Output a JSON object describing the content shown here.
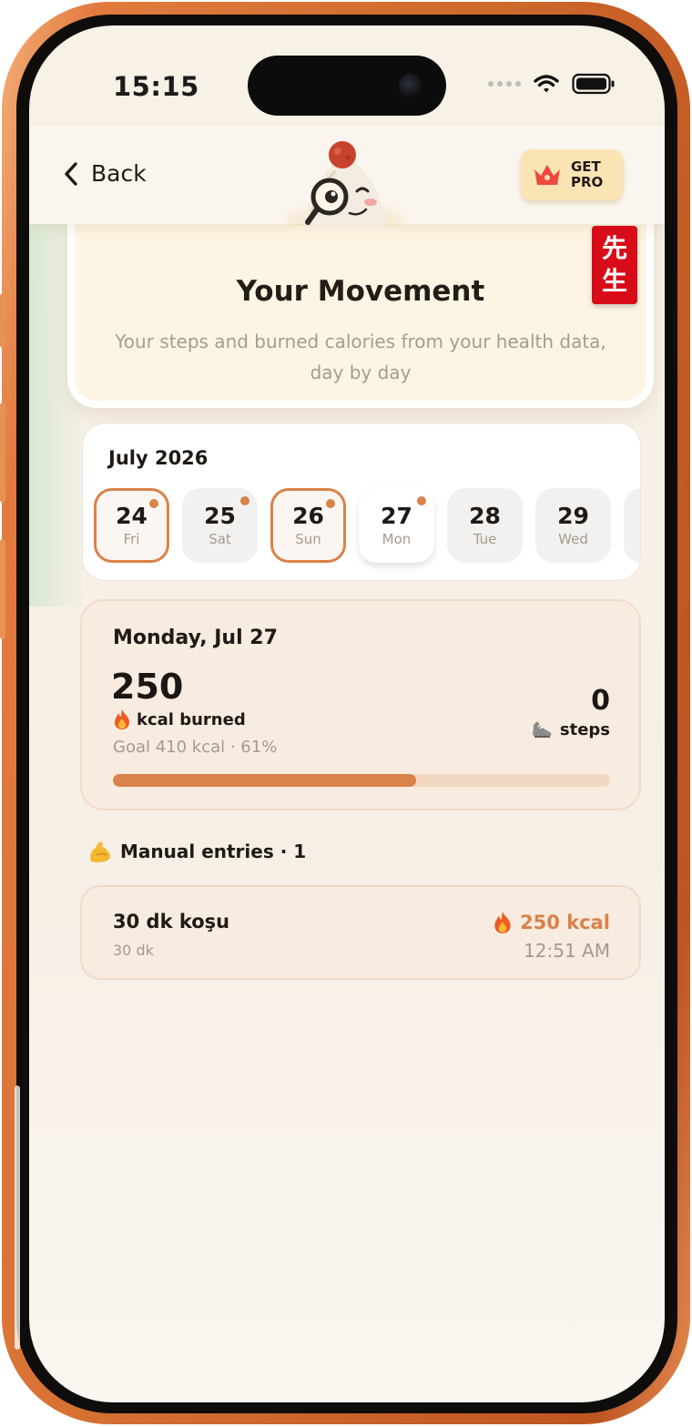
{
  "status_bar": {
    "time": "15:15",
    "icons": [
      "signal-dots-icon",
      "wifi-icon",
      "battery-icon"
    ]
  },
  "header": {
    "back_label": "Back",
    "mascot": "onigiri-mascot-with-magnifier",
    "get_pro_line1": "GET",
    "get_pro_line2": "PRO"
  },
  "hero": {
    "title": "Your Movement",
    "subtitle": "Your steps and burned calories from your health data, day by day",
    "badge_line1": "先",
    "badge_line2": "生"
  },
  "calendar": {
    "month": "July 2026",
    "days": [
      {
        "num": "24",
        "name": "Fri",
        "ring": true,
        "today": false,
        "dot": true
      },
      {
        "num": "25",
        "name": "Sat",
        "ring": false,
        "today": false,
        "dot": true
      },
      {
        "num": "26",
        "name": "Sun",
        "ring": true,
        "today": false,
        "dot": true
      },
      {
        "num": "27",
        "name": "Mon",
        "ring": false,
        "today": true,
        "dot": true
      },
      {
        "num": "28",
        "name": "Tue",
        "ring": false,
        "today": false,
        "dot": false
      },
      {
        "num": "29",
        "name": "Wed",
        "ring": false,
        "today": false,
        "dot": false
      },
      {
        "num": "",
        "name": "",
        "ring": false,
        "today": false,
        "dot": false
      }
    ]
  },
  "summary": {
    "date": "Monday, Jul 27",
    "kcal_value": "250",
    "kcal_label": "kcal burned",
    "goal_text": "Goal 410 kcal · 61%",
    "steps_value": "0",
    "steps_label": "steps",
    "progress_fraction": 0.61,
    "accent_color": "#d9824a"
  },
  "manual_entries": {
    "heading": "Manual entries · 1",
    "items": [
      {
        "name": "30 dk koşu",
        "duration": "30 dk",
        "kcal": "250 kcal",
        "time": "12:51 AM"
      }
    ]
  }
}
